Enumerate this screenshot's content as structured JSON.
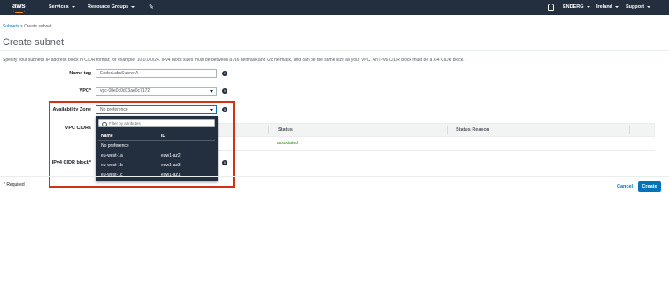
{
  "nav": {
    "logo": "aws",
    "services": "Services",
    "resource_groups": "Resource Groups",
    "pin": "✎",
    "account": "ENDERG",
    "region": "Ireland",
    "support": "Support"
  },
  "breadcrumb": {
    "parent": "Subnets",
    "separator": ">",
    "current": "Create subnet"
  },
  "page_title": "Create subnet",
  "description": "Specify your subnet's IP address block in CIDR format; for example, 10.0.0.0/24. IPv4 block sizes must be between a /16 netmask and /28 netmask, and can be the same size as your VPC. An IPv6 CIDR block must be a /64 CIDR block.",
  "form": {
    "name_tag_label": "Name tag",
    "name_tag_value": "EnderLabsSubnetA",
    "vpc_label": "VPC*",
    "vpc_value": "vpc-08e0c0d13ae0c7172",
    "az_label": "Availability Zone",
    "az_value": "No preference",
    "vpc_cidrs_label": "VPC CIDRs",
    "ipv4_label": "IPv4 CIDR block*"
  },
  "cidr_table": {
    "columns": [
      "Status",
      "Status Reason"
    ],
    "rows": [
      {
        "status": "associated"
      }
    ]
  },
  "az_dropdown": {
    "search_placeholder": "Filter by attributes",
    "columns": {
      "name": "Name",
      "id": "ID"
    },
    "options": [
      {
        "name": "No preference",
        "id": ""
      },
      {
        "name": "eu-west-1a",
        "id": "euw1-az2"
      },
      {
        "name": "eu-west-1b",
        "id": "euw1-az3"
      },
      {
        "name": "eu-west-1c",
        "id": "euw1-az1"
      }
    ]
  },
  "footer": {
    "required_note": "* Required",
    "cancel": "Cancel",
    "create": "Create"
  },
  "colors": {
    "nav_bg": "#232f3e",
    "accent": "#ff9900",
    "link": "#0073bb",
    "highlight_box": "#d13212",
    "success": "#1d8102"
  }
}
